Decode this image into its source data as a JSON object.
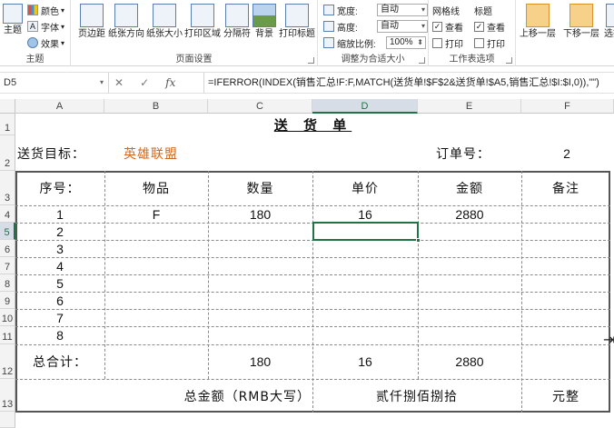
{
  "ribbon": {
    "themes": {
      "label": "主题",
      "colors": "颜色",
      "fonts": "字体",
      "effects": "效果",
      "group": "主题"
    },
    "page_setup": {
      "group": "页面设置",
      "buttons": [
        "页边距",
        "纸张方向",
        "纸张大小",
        "打印区域",
        "分隔符",
        "背景",
        "打印标题"
      ]
    },
    "scale": {
      "group": "调整为合适大小",
      "width_label": "宽度:",
      "width_value": "自动",
      "height_label": "高度:",
      "height_value": "自动",
      "scale_label": "缩放比例:",
      "scale_value": "100%"
    },
    "sheet_options": {
      "group": "工作表选项",
      "gridlines": "网格线",
      "headings": "标题",
      "view": "查看",
      "print": "打印"
    },
    "arrange": {
      "bring_forward": "上移一层",
      "send_backward": "下移一层",
      "selection_pane": "选择窗"
    }
  },
  "formula_bar": {
    "name_box": "D5",
    "formula": "=IFERROR(INDEX(销售汇总!F:F,MATCH(送货单!$F$2&送货单!$A5,销售汇总!$I:$I,0)),\"\")"
  },
  "grid": {
    "columns": [
      "A",
      "B",
      "C",
      "D",
      "E",
      "F"
    ],
    "rows": [
      "1",
      "2",
      "3",
      "4",
      "5",
      "6",
      "7",
      "8",
      "9",
      "10",
      "11",
      "12",
      "13"
    ],
    "selected_column": "D",
    "selected_row": "5"
  },
  "sheet": {
    "title": "送 货 单",
    "dest_label": "送货目标：",
    "dest_value": "英雄联盟",
    "order_label": "订单号：",
    "order_value": "2",
    "headers": [
      "序号：",
      "物品",
      "数量",
      "单价",
      "金额",
      "备注"
    ],
    "rows": [
      {
        "no": "1",
        "item": "F",
        "qty": "180",
        "price": "16",
        "amount": "2880"
      },
      {
        "no": "2",
        "item": "",
        "qty": "",
        "price": "",
        "amount": ""
      },
      {
        "no": "3",
        "item": "",
        "qty": "",
        "price": "",
        "amount": ""
      },
      {
        "no": "4",
        "item": "",
        "qty": "",
        "price": "",
        "amount": ""
      },
      {
        "no": "5",
        "item": "",
        "qty": "",
        "price": "",
        "amount": ""
      },
      {
        "no": "6",
        "item": "",
        "qty": "",
        "price": "",
        "amount": ""
      },
      {
        "no": "7",
        "item": "",
        "qty": "",
        "price": "",
        "amount": ""
      },
      {
        "no": "8",
        "item": "",
        "qty": "",
        "price": "",
        "amount": ""
      }
    ],
    "total_label": "总合计：",
    "total_qty": "180",
    "total_price": "16",
    "total_amount": "2880",
    "rmb_label": "总金额（RMB大写）",
    "rmb_value": "贰仟捌佰捌拾",
    "rmb_suffix": "元整"
  },
  "colors": {
    "accent": "#217346",
    "dest_text": "#d2691e"
  }
}
